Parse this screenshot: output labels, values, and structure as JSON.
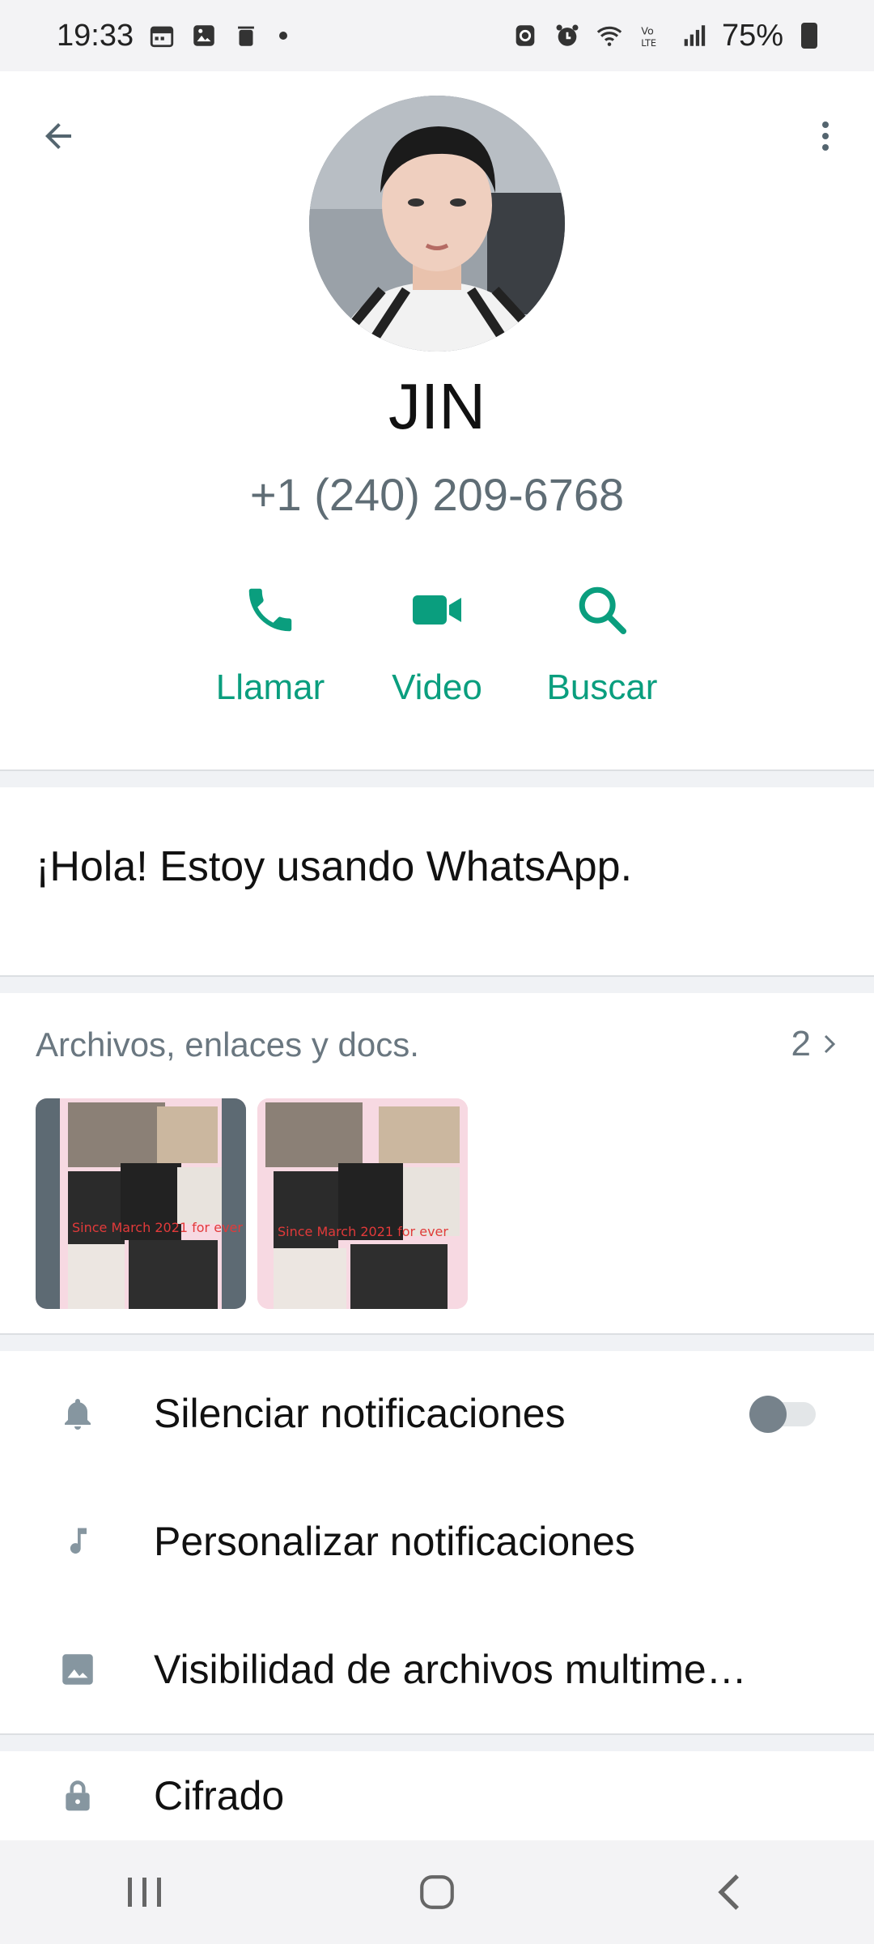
{
  "status_bar": {
    "time": "19:33",
    "battery": "75%"
  },
  "contact": {
    "name": "JIN",
    "phone": "+1 (240) 209-6768"
  },
  "actions": [
    {
      "label": "Llamar",
      "icon": "phone-icon"
    },
    {
      "label": "Video",
      "icon": "video-icon"
    },
    {
      "label": "Buscar",
      "icon": "search-icon"
    }
  ],
  "about": {
    "text": "¡Hola! Estoy usando WhatsApp."
  },
  "media": {
    "title": "Archivos, enlaces y docs.",
    "count": "2"
  },
  "settings": [
    {
      "label": "Silenciar notificaciones",
      "icon": "bell-icon",
      "toggle": false
    },
    {
      "label": "Personalizar notificaciones",
      "icon": "music-note-icon"
    },
    {
      "label": "Visibilidad de archivos multime…",
      "icon": "image-icon"
    }
  ],
  "encryption": {
    "label": "Cifrado",
    "icon": "lock-icon"
  },
  "colors": {
    "accent": "#0a9e7e",
    "secondary_text": "#6a7780",
    "divider": "#f0f2f5"
  }
}
